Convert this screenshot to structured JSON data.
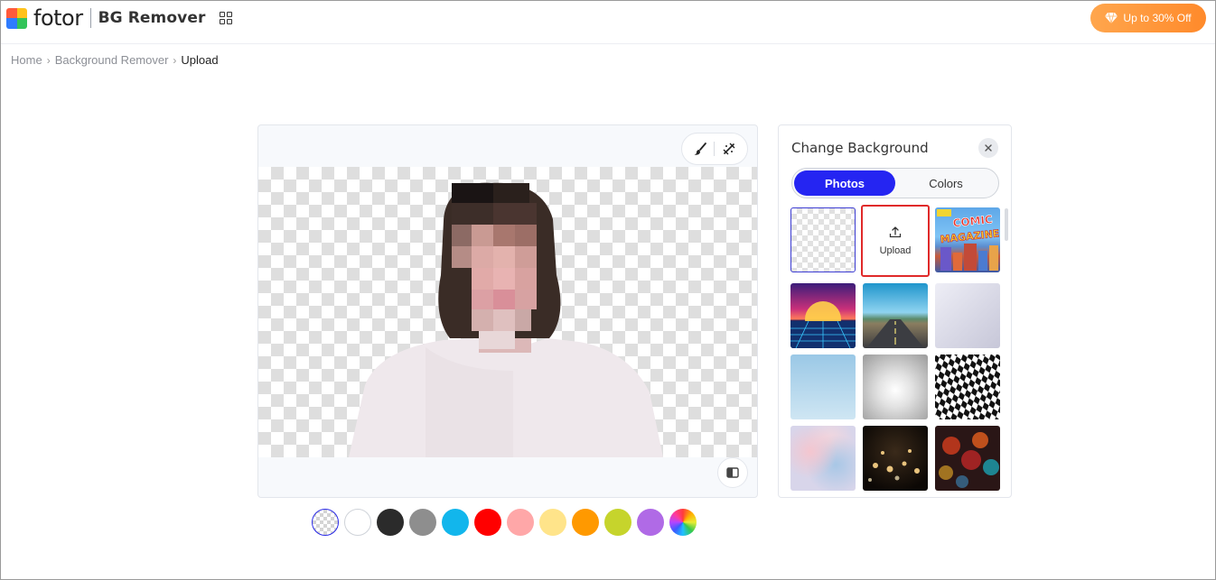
{
  "header": {
    "logo_text": "fotor",
    "product_name": "BG Remover",
    "promo_label": "Up to 30% Off"
  },
  "breadcrumb": [
    "Home",
    "Background Remover",
    "Upload"
  ],
  "editor": {
    "tools": [
      "brush-icon",
      "erase-restore-icon"
    ],
    "compare_icon": "compare-icon"
  },
  "swatches": [
    {
      "name": "transparent",
      "color": "transparent"
    },
    {
      "name": "white",
      "color": "#ffffff"
    },
    {
      "name": "black",
      "color": "#2b2b2b"
    },
    {
      "name": "gray",
      "color": "#8e8e8e"
    },
    {
      "name": "sky-blue",
      "color": "#12b6ec"
    },
    {
      "name": "red",
      "color": "#ff0000"
    },
    {
      "name": "pink",
      "color": "#ffa7a8"
    },
    {
      "name": "light-yellow",
      "color": "#ffe48a"
    },
    {
      "name": "orange",
      "color": "#ff9900"
    },
    {
      "name": "lime",
      "color": "#c6d42c"
    },
    {
      "name": "purple",
      "color": "#b06ae6"
    },
    {
      "name": "custom",
      "color": "rainbow"
    }
  ],
  "panel": {
    "title": "Change Background",
    "tabs": [
      {
        "label": "Photos",
        "active": true
      },
      {
        "label": "Colors",
        "active": false
      }
    ],
    "upload_label": "Upload",
    "tiles": [
      "transparent",
      "upload",
      "comic-magazine",
      "retro-sunset",
      "open-road",
      "white-studio",
      "sky-gradient",
      "gray-radial",
      "checker-warp",
      "pastel-clouds",
      "heart-bokeh",
      "rain-bokeh"
    ]
  }
}
